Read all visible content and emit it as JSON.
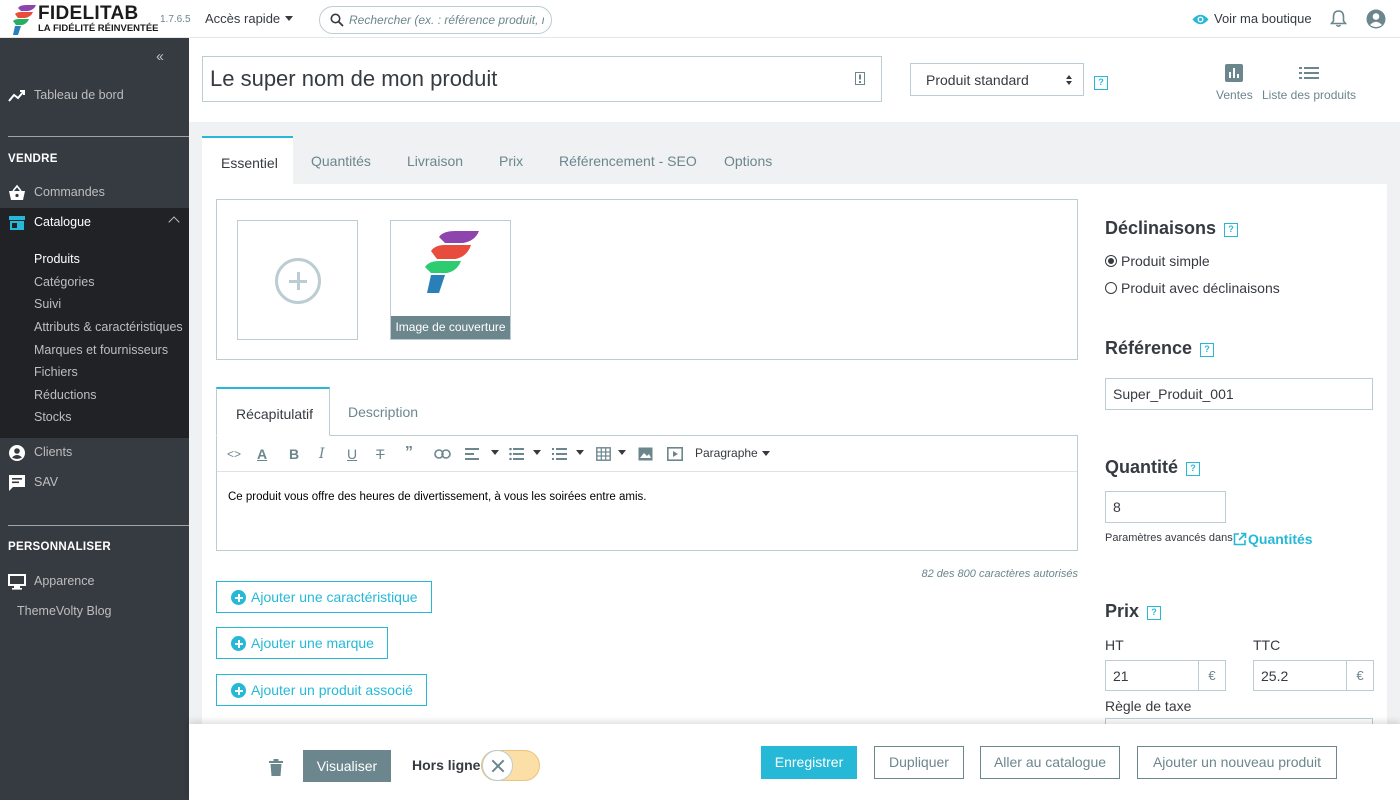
{
  "header": {
    "logo_title": "FIDELITAB",
    "logo_tagline": "LA FIDÉLITÉ RÉINVENTÉE",
    "version": "1.7.6.5",
    "quick_access": "Accès rapide",
    "search_placeholder": "Rechercher (ex. : référence produit, nom",
    "view_shop": "Voir ma boutique"
  },
  "sidebar": {
    "dashboard": "Tableau de bord",
    "section_sell": "VENDRE",
    "orders": "Commandes",
    "catalog": "Catalogue",
    "catalog_items": [
      "Produits",
      "Catégories",
      "Suivi",
      "Attributs & caractéristiques",
      "Marques et fournisseurs",
      "Fichiers",
      "Réductions",
      "Stocks"
    ],
    "customers": "Clients",
    "support": "SAV",
    "section_customize": "PERSONNALISER",
    "appearance": "Apparence",
    "blog": "ThemeVolty Blog"
  },
  "product": {
    "name": "Le super nom de mon produit",
    "type": "Produit standard",
    "tool_sales": "Ventes",
    "tool_list": "Liste des produits"
  },
  "tabs": [
    "Essentiel",
    "Quantités",
    "Livraison",
    "Prix",
    "Référencement - SEO",
    "Options"
  ],
  "images": {
    "cover_caption": "Image de couverture"
  },
  "editor": {
    "tabs": [
      "Récapitulatif",
      "Description"
    ],
    "paragraph": "Paragraphe",
    "content": "Ce produit vous offre des heures de divertissement, à vous les soirées entre amis.",
    "counter": "82 des 800 caractères autorisés"
  },
  "actions": {
    "add_feature": "Ajouter une caractéristique",
    "add_brand": "Ajouter une marque",
    "add_related": "Ajouter un produit associé"
  },
  "right": {
    "combinations_title": "Déclinaisons",
    "simple_product": "Produit simple",
    "with_combinations": "Produit avec déclinaisons",
    "reference_title": "Référence",
    "reference_value": "Super_Produit_001",
    "quantity_title": "Quantité",
    "quantity_value": "8",
    "advanced_params": "Paramètres avancés dans",
    "quantities_link": "Quantités",
    "price_title": "Prix",
    "ht_label": "HT",
    "ttc_label": "TTC",
    "ht_value": "21",
    "ttc_value": "25.2",
    "currency": "€",
    "tax_rule": "Règle de taxe"
  },
  "footer": {
    "preview": "Visualiser",
    "offline": "Hors ligne",
    "save": "Enregistrer",
    "duplicate": "Dupliquer",
    "go_catalog": "Aller au catalogue",
    "add_new": "Ajouter un nouveau produit"
  },
  "colors": {
    "accent": "#25b9d7",
    "sidebar_bg": "#363a41",
    "sidebar_active": "#202226",
    "muted": "#6c868e",
    "border": "#bbcdd2"
  }
}
